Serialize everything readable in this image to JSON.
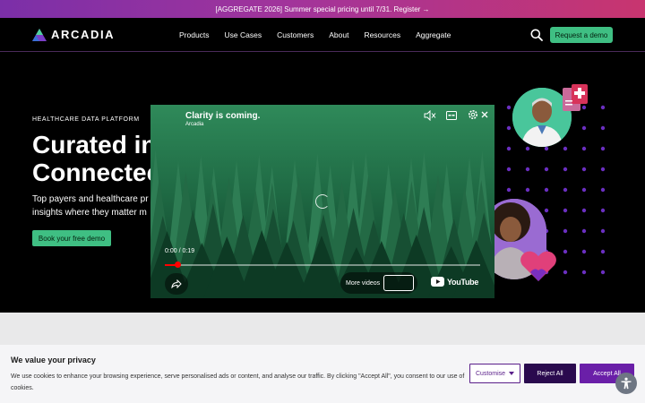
{
  "promo": {
    "text": "[AGGREGATE 2026] Summer special pricing until 7/31. Register →"
  },
  "nav": {
    "logo_text": "ARCADIA",
    "links": [
      "Products",
      "Use Cases",
      "Customers",
      "About",
      "Resources",
      "Aggregate"
    ],
    "search_icon": "search-icon",
    "cta": "Request a demo"
  },
  "hero": {
    "eyebrow": "HEALTHCARE DATA PLATFORM",
    "title_lines": [
      "Curated in",
      "Connectec"
    ],
    "body_lines": [
      "Top payers and healthcare pr",
      "insights where they matter m"
    ],
    "cta": "Book your free demo"
  },
  "video": {
    "title": "Clarity is coming.",
    "channel": "Arcadia",
    "time_current": "0:00",
    "time_separator": "/",
    "time_total": "0:19",
    "progress": 0.04,
    "more_videos": "More videos",
    "brand": "YouTube"
  },
  "cookie": {
    "title": "We value your privacy",
    "text": "We use cookies to enhance your browsing experience, serve personalised ads or content, and analyse our traffic. By clicking \"Accept All\", you consent to our use of cookies.",
    "customise": "Customise",
    "reject": "Reject All",
    "accept": "Accept All"
  },
  "colors": {
    "accent_green": "#3fbf83",
    "purple_dark": "#2a0a4e",
    "purple": "#6a1fa8"
  }
}
